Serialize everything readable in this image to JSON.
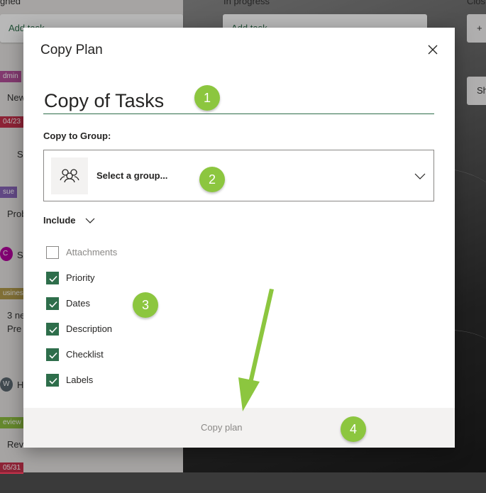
{
  "background": {
    "columns": [
      {
        "title": "gned"
      },
      {
        "title": "In progress"
      },
      {
        "title": "Clos"
      }
    ],
    "add_task_left": "Add task",
    "add_task_mid": "Add task",
    "right_short": "Sh",
    "right_plus": "+",
    "side_items": [
      {
        "tag": "dmin",
        "text": "New"
      },
      {
        "tag": "04/23",
        "text": "S"
      },
      {
        "tag": "sue",
        "text": "Prob"
      },
      {
        "tag": "C",
        "text": "S"
      },
      {
        "tag": "usiness",
        "text": "3 ne"
      },
      {
        "tag": "",
        "text": "Pre"
      },
      {
        "tag": "W",
        "text": "H"
      },
      {
        "tag": "eview",
        "text": "Rev"
      },
      {
        "tag": "05/31",
        "text": ""
      }
    ]
  },
  "dialog": {
    "title": "Copy Plan",
    "plan_name_value": "Copy of Tasks",
    "copy_to_group_label": "Copy to Group:",
    "group_placeholder": "Select a group...",
    "include_label": "Include",
    "options": [
      {
        "label": "Attachments",
        "checked": false
      },
      {
        "label": "Priority",
        "checked": true
      },
      {
        "label": "Dates",
        "checked": true
      },
      {
        "label": "Description",
        "checked": true
      },
      {
        "label": "Checklist",
        "checked": true
      },
      {
        "label": "Labels",
        "checked": true
      }
    ],
    "copy_button": "Copy plan"
  },
  "annotations": [
    "1",
    "2",
    "3",
    "4"
  ],
  "colors": {
    "accent": "#2e6e4b",
    "badge": "#8cc63f",
    "footer": "#f3f2f1"
  }
}
